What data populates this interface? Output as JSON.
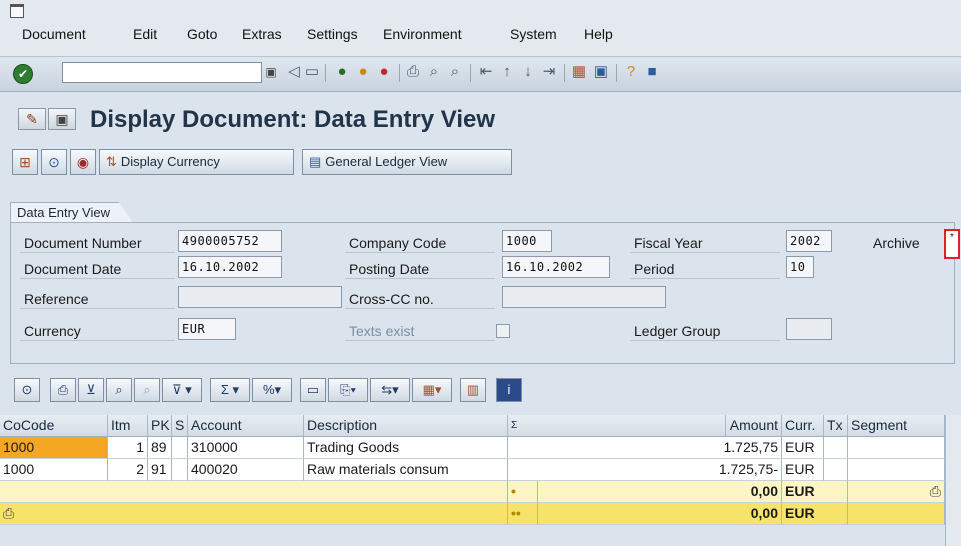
{
  "menubar": {
    "items": [
      "Document",
      "Edit",
      "Goto",
      "Extras",
      "Settings",
      "Environment",
      "System",
      "Help"
    ]
  },
  "toolbar": {
    "command_value": "",
    "icons": [
      "enter-icon",
      "command-dropdown-icon",
      "back-icon",
      "save-icon",
      "green-back-icon",
      "exit-icon",
      "cancel-icon",
      "print-icon",
      "find-icon",
      "find-next-icon",
      "first-page-icon",
      "previous-page-icon",
      "next-page-icon",
      "last-page-icon",
      "new-session-icon",
      "shortcut-icon",
      "help-icon",
      "layout-icon"
    ]
  },
  "title": {
    "text": "Display Document: Data Entry View"
  },
  "app_toolbar": {
    "display_currency": "Display Currency",
    "general_ledger_view": "General Ledger View"
  },
  "entry_view": {
    "tab_label": "Data Entry View",
    "doc_number_label": "Document Number",
    "doc_number": "4900005752",
    "company_code_label": "Company Code",
    "company_code": "1000",
    "fiscal_year_label": "Fiscal Year",
    "fiscal_year": "2002",
    "archive_label": "Archive",
    "archive_value": "*",
    "doc_date_label": "Document Date",
    "doc_date": "16.10.2002",
    "posting_date_label": "Posting Date",
    "posting_date": "16.10.2002",
    "period_label": "Period",
    "period": "10",
    "reference_label": "Reference",
    "reference": "",
    "cross_cc_label": "Cross-CC no.",
    "cross_cc": "",
    "currency_label": "Currency",
    "currency": "EUR",
    "texts_exist_label": "Texts exist",
    "ledger_group_label": "Ledger Group",
    "ledger_group": ""
  },
  "table": {
    "headers": [
      "CoCode",
      "Itm",
      "PK",
      "S",
      "Account",
      "Description",
      "Σ",
      "Amount",
      "Curr.",
      "Tx",
      "Segment"
    ],
    "rows": [
      {
        "cocode": "1000",
        "itm": "1",
        "pk": "89",
        "s": "",
        "account": "310000",
        "description": "Trading Goods",
        "amount": "1.725,75",
        "curr": "EUR",
        "tx": "",
        "segment": ""
      },
      {
        "cocode": "1000",
        "itm": "2",
        "pk": "91",
        "s": "",
        "account": "400020",
        "description": "Raw materials consum",
        "amount": "1.725,75-",
        "curr": "EUR",
        "tx": "",
        "segment": ""
      }
    ],
    "subtotal": {
      "marker": "•",
      "amount": "0,00",
      "curr": "EUR"
    },
    "total": {
      "marker": "••",
      "amount": "0,00",
      "curr": "EUR"
    }
  },
  "colors": {
    "selected_cell": "#f5a623",
    "subtotal_row": "#fdf5c4",
    "total_row": "#f8e36a",
    "archive_highlight": "#e0202a"
  }
}
